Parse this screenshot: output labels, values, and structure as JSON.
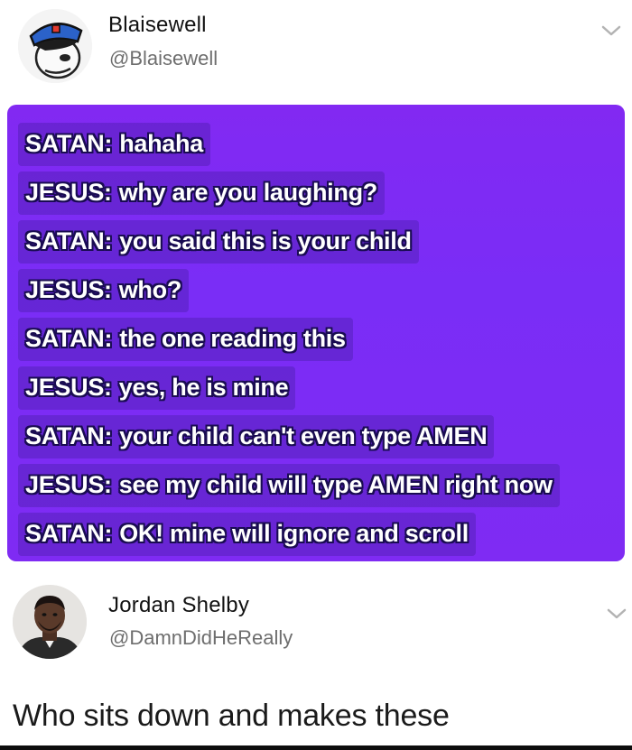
{
  "tweet1": {
    "display_name": "Blaisewell",
    "handle": "@Blaisewell",
    "avatar_icon": "police-cap-cartoon-avatar",
    "menu_icon": "chevron-down-icon"
  },
  "message_card": {
    "background_color": "#7f2bf3",
    "lines": [
      {
        "speaker": "SATAN:",
        "text": "hahaha"
      },
      {
        "speaker": "JESUS:",
        "text": "why are you laughing?"
      },
      {
        "speaker": "SATAN:",
        "text": "you said this is your child"
      },
      {
        "speaker": "JESUS:",
        "text": "who?"
      },
      {
        "speaker": "SATAN:",
        "text": "the one reading this"
      },
      {
        "speaker": "JESUS:",
        "text": "yes, he is mine"
      },
      {
        "speaker": "SATAN:",
        "text": "your child can't even type AMEN"
      },
      {
        "speaker": "JESUS:",
        "text": "see my child will type AMEN right now"
      },
      {
        "speaker": "SATAN:",
        "text": "OK! mine will ignore and scroll"
      }
    ]
  },
  "tweet2": {
    "display_name": "Jordan Shelby",
    "handle": "@DamnDidHeReally",
    "avatar_icon": "profile-photo-avatar",
    "menu_icon": "chevron-down-icon",
    "text": "Who sits down and makes these"
  }
}
